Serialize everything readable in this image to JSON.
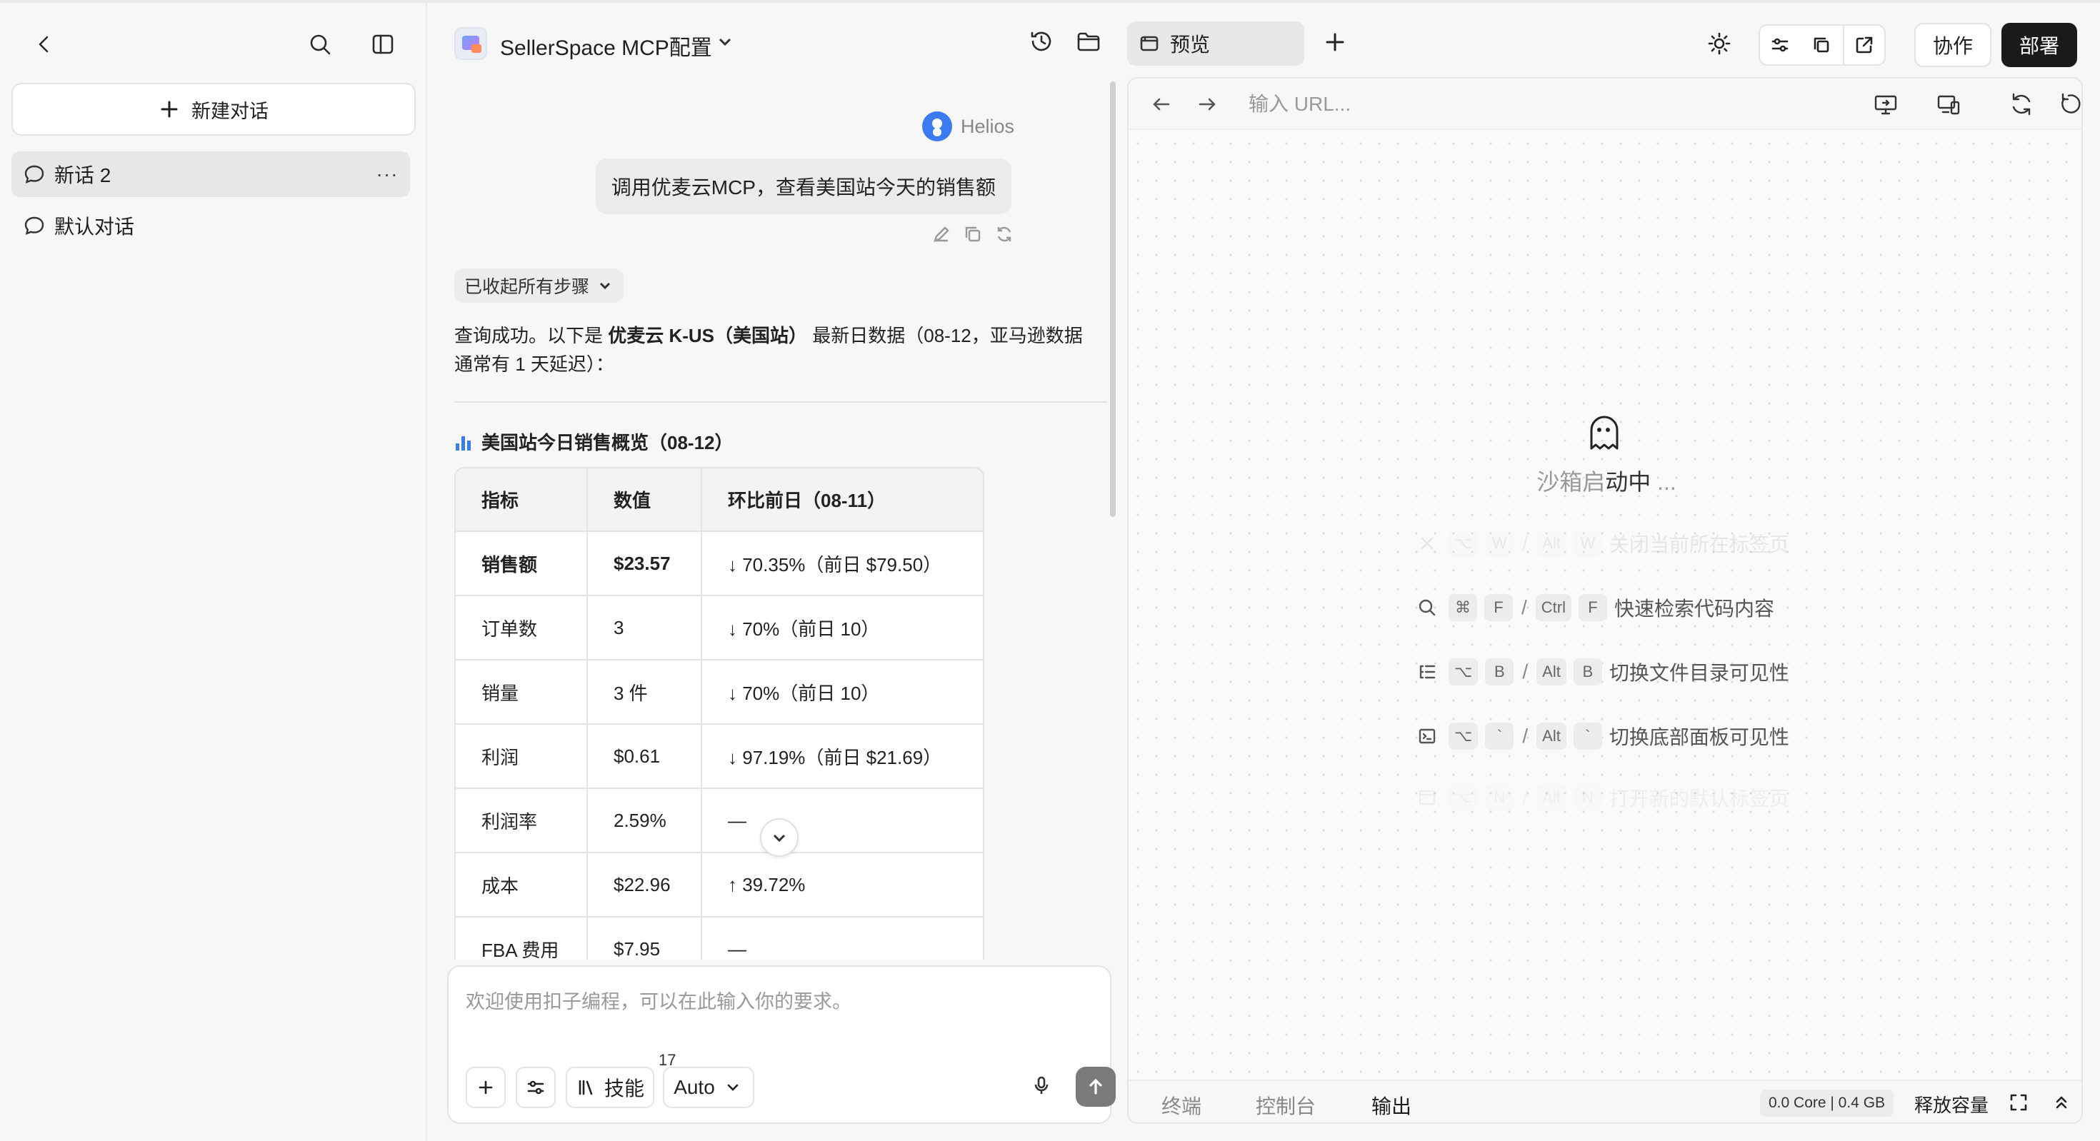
{
  "sidebar": {
    "new_chat_label": "新建对话",
    "conversations": [
      {
        "label": "新话 2",
        "more": "···"
      },
      {
        "label": "默认对话"
      }
    ]
  },
  "chat": {
    "project_title": "SellerSpace MCP配置",
    "user_name": "Helios",
    "user_message": "调用优麦云MCP，查看美国站今天的销售额",
    "collapse_label": "已收起所有步骤",
    "answer_prefix": "查询成功。以下是",
    "answer_bold": "优麦云 K-US（美国站）",
    "answer_suffix": "最新日数据（08-12，亚马逊数据通常有 1 天延迟）：",
    "section_title": "美国站今日销售概览（08-12）",
    "table": {
      "headers": [
        "指标",
        "数值",
        "环比前日（08-11）"
      ],
      "rows": [
        [
          "销售额",
          "$23.57",
          "↓ 70.35%（前日 $79.50）"
        ],
        [
          "订单数",
          "3",
          "↓ 70%（前日 10）"
        ],
        [
          "销量",
          "3 件",
          "↓ 70%（前日 10）"
        ],
        [
          "利润",
          "$0.61",
          "↓ 97.19%（前日 $21.69）"
        ],
        [
          "利润率",
          "2.59%",
          "—"
        ],
        [
          "成本",
          "$22.96",
          "↑ 39.72%"
        ],
        [
          "FBA 费用",
          "$7.95",
          "—"
        ]
      ]
    },
    "composer": {
      "placeholder": "欢迎使用扣子编程，可以在此输入你的要求。",
      "skills_label": "技能",
      "skills_count": "17",
      "mode_label": "Auto"
    }
  },
  "preview_panel": {
    "tab_label": "预览",
    "collab_label": "协作",
    "deploy_label": "部署",
    "url_placeholder": "输入 URL...",
    "loading_prefix": "沙箱启",
    "loading_strong": "动中",
    "loading_suffix": " ...",
    "shortcuts": [
      {
        "icon": "close-icon",
        "mac_keys": [
          "⌥",
          "W"
        ],
        "win_keys": [
          "Alt",
          "W"
        ],
        "label": "关闭当前所在标签页"
      },
      {
        "icon": "search-icon",
        "mac_keys": [
          "⌘",
          "F"
        ],
        "win_keys": [
          "Ctrl",
          "F"
        ],
        "label": "快速检索代码内容"
      },
      {
        "icon": "list-tree-icon",
        "mac_keys": [
          "⌥",
          "B"
        ],
        "win_keys": [
          "Alt",
          "B"
        ],
        "label": "切换文件目录可见性"
      },
      {
        "icon": "terminal-icon",
        "mac_keys": [
          "⌥",
          "`"
        ],
        "win_keys": [
          "Alt",
          "`"
        ],
        "label": "切换底部面板可见性"
      },
      {
        "icon": "new-tab-icon",
        "mac_keys": [
          "⌥",
          "N"
        ],
        "win_keys": [
          "Alt",
          "N"
        ],
        "label": "打开新的默认标签页"
      }
    ],
    "bottom_tabs": [
      "终端",
      "控制台",
      "输出"
    ],
    "resource_badge": "0.0 Core | 0.4 GB",
    "release_label": "释放容量"
  }
}
